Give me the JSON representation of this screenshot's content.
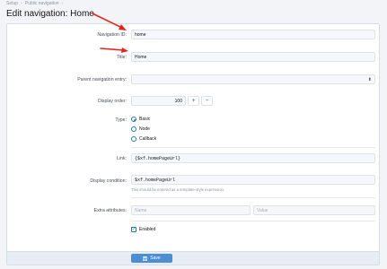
{
  "breadcrumb": [
    "Setup",
    "Public navigation"
  ],
  "page": {
    "title": "Edit navigation: Home"
  },
  "form": {
    "navigation_id": {
      "label": "Navigation ID:",
      "value": "home"
    },
    "title": {
      "label": "Title:",
      "value": "Home"
    },
    "parent": {
      "label": "Parent navigation entry:",
      "value": ""
    },
    "display_order": {
      "label": "Display order:",
      "value": "100",
      "plus": "+",
      "minus": "−"
    },
    "type": {
      "label": "Type:",
      "options": [
        "Basic",
        "Node",
        "Callback"
      ],
      "selected": "Basic"
    },
    "link": {
      "label": "Link:",
      "value": "{$xf.homePageUrl}"
    },
    "display_condition": {
      "label": "Display condition:",
      "value": "$xf.homePageUrl",
      "hint": "This should be entered as a template-style expression."
    },
    "extra_attributes": {
      "label": "Extra attributes:",
      "name_placeholder": "Name",
      "value_placeholder": "Value"
    },
    "enabled": {
      "label": "Enabled",
      "checked": true
    }
  },
  "footer": {
    "save_label": "Save",
    "save_icon": "save-icon"
  },
  "colors": {
    "accent": "#2577b1",
    "button": "#4b8ed3",
    "arrow": "#e0271f"
  }
}
